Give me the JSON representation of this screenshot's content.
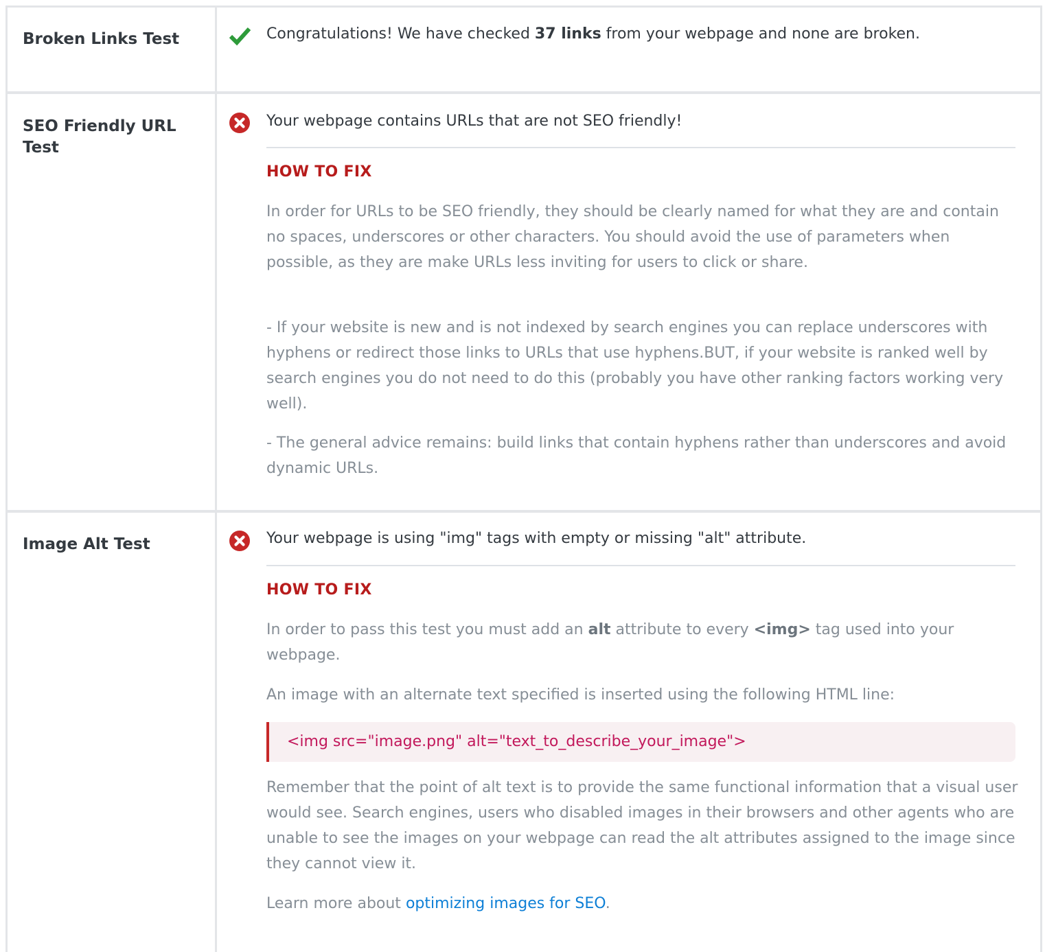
{
  "broken_links": {
    "label": "Broken Links Test",
    "status": "pass",
    "summary_prefix": "Congratulations! We have checked ",
    "summary_bold": "37 links",
    "summary_suffix": " from your webpage and none are broken."
  },
  "seo_url": {
    "label": "SEO Friendly URL Test",
    "status": "fail",
    "summary": "Your webpage contains URLs that are not SEO friendly!",
    "fix_title": "HOW TO FIX",
    "para1": "In order for URLs to be SEO friendly, they should be clearly named for what they are and contain no spaces, underscores or other characters. You should avoid the use of parameters when possible, as they are make URLs less inviting for users to click or share.",
    "para2": "- If your website is new and is not indexed by search engines you can replace underscores with hyphens or redirect those links to URLs that use hyphens.BUT, if your website is ranked well by search engines you do not need to do this (probably you have other ranking factors working very well).",
    "para3": "- The general advice remains: build links that contain hyphens rather than underscores and avoid dynamic URLs."
  },
  "image_alt": {
    "label": "Image Alt Test",
    "status": "fail",
    "summary": "Your webpage is using \"img\" tags with empty or missing \"alt\" attribute.",
    "fix_title": "HOW TO FIX",
    "para1_a": "In order to pass this test you must add an ",
    "para1_b": "alt",
    "para1_c": " attribute to every ",
    "para1_d": "<img>",
    "para1_e": " tag used into your webpage.",
    "para2": "An image with an alternate text specified is inserted using the following HTML line:",
    "code": "<img src=\"image.png\" alt=\"text_to_describe_your_image\">",
    "para3": "Remember that the point of alt text is to provide the same functional information that a visual user would see. Search engines, users who disabled images in their browsers and other agents who are unable to see the images on your webpage can read the alt attributes assigned to the image since they cannot view it.",
    "para4_prefix": "Learn more about ",
    "para4_link": "optimizing images for SEO",
    "para4_suffix": "."
  },
  "colors": {
    "pass_icon": "#2e9b3a",
    "fail_icon": "#c62828",
    "fix_title": "#b71c1c",
    "link": "#0d7fd6",
    "code_text": "#c2185b"
  },
  "icons": {
    "pass": "checkmark-icon",
    "fail": "error-x-circle-icon"
  }
}
